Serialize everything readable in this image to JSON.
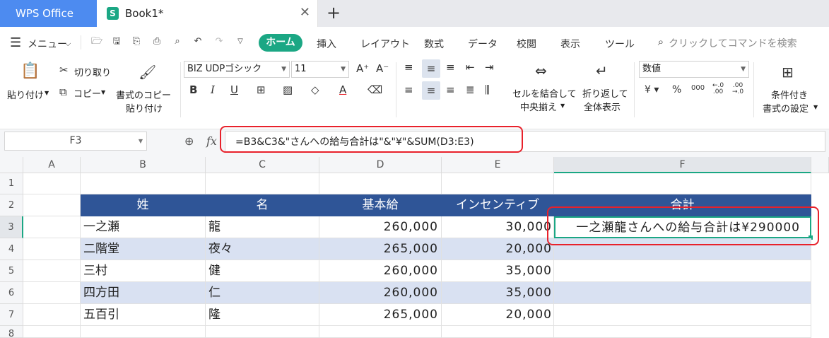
{
  "app": {
    "name": "WPS Office",
    "doc_tab": "Book1*"
  },
  "menu": {
    "main_label": "メニュー",
    "tabs": [
      "ホーム",
      "挿入",
      "レイアウト",
      "数式",
      "データ",
      "校閲",
      "表示",
      "ツール"
    ],
    "search_placeholder": "クリックしてコマンドを検索"
  },
  "ribbon": {
    "paste": "貼り付け",
    "cut": "切り取り",
    "copy": "コピー",
    "format_painter_1": "書式のコピー",
    "format_painter_2": "貼り付け",
    "font_name": "BIZ UDPゴシック",
    "font_size": "11",
    "merge_1": "セルを結合して",
    "merge_2": "中央揃え",
    "wrap_1": "折り返して",
    "wrap_2": "全体表示",
    "number_format": "数値",
    "cond_1": "条件付き",
    "cond_2": "書式の設定"
  },
  "formula_bar": {
    "name_box": "F3",
    "fx": "fx",
    "formula": "=B3&C3&\"さんへの給与合計は\"&\"¥\"&SUM(D3:E3)"
  },
  "sheet": {
    "columns": [
      "A",
      "B",
      "C",
      "D",
      "E",
      "F"
    ],
    "rows": [
      "1",
      "2",
      "3",
      "4",
      "5",
      "6",
      "7",
      "8"
    ],
    "headers": {
      "b": "姓",
      "c": "名",
      "d": "基本給",
      "e": "インセンティブ",
      "f": "合計"
    },
    "data": [
      {
        "b": "一之瀬",
        "c": "龍",
        "d": "260,000",
        "e": "30,000",
        "f": "一之瀬龍さんへの給与合計は¥290000"
      },
      {
        "b": "二階堂",
        "c": "夜々",
        "d": "265,000",
        "e": "20,000",
        "f": ""
      },
      {
        "b": "三村",
        "c": "健",
        "d": "260,000",
        "e": "35,000",
        "f": ""
      },
      {
        "b": "四方田",
        "c": "仁",
        "d": "260,000",
        "e": "35,000",
        "f": ""
      },
      {
        "b": "五百引",
        "c": "隆",
        "d": "265,000",
        "e": "20,000",
        "f": ""
      }
    ]
  },
  "colors": {
    "accent": "#1ba784",
    "header_fill": "#2f5597",
    "band_fill": "#d9e1f2",
    "highlight": "#e8212b",
    "wps_blue": "#4d8bf0"
  }
}
